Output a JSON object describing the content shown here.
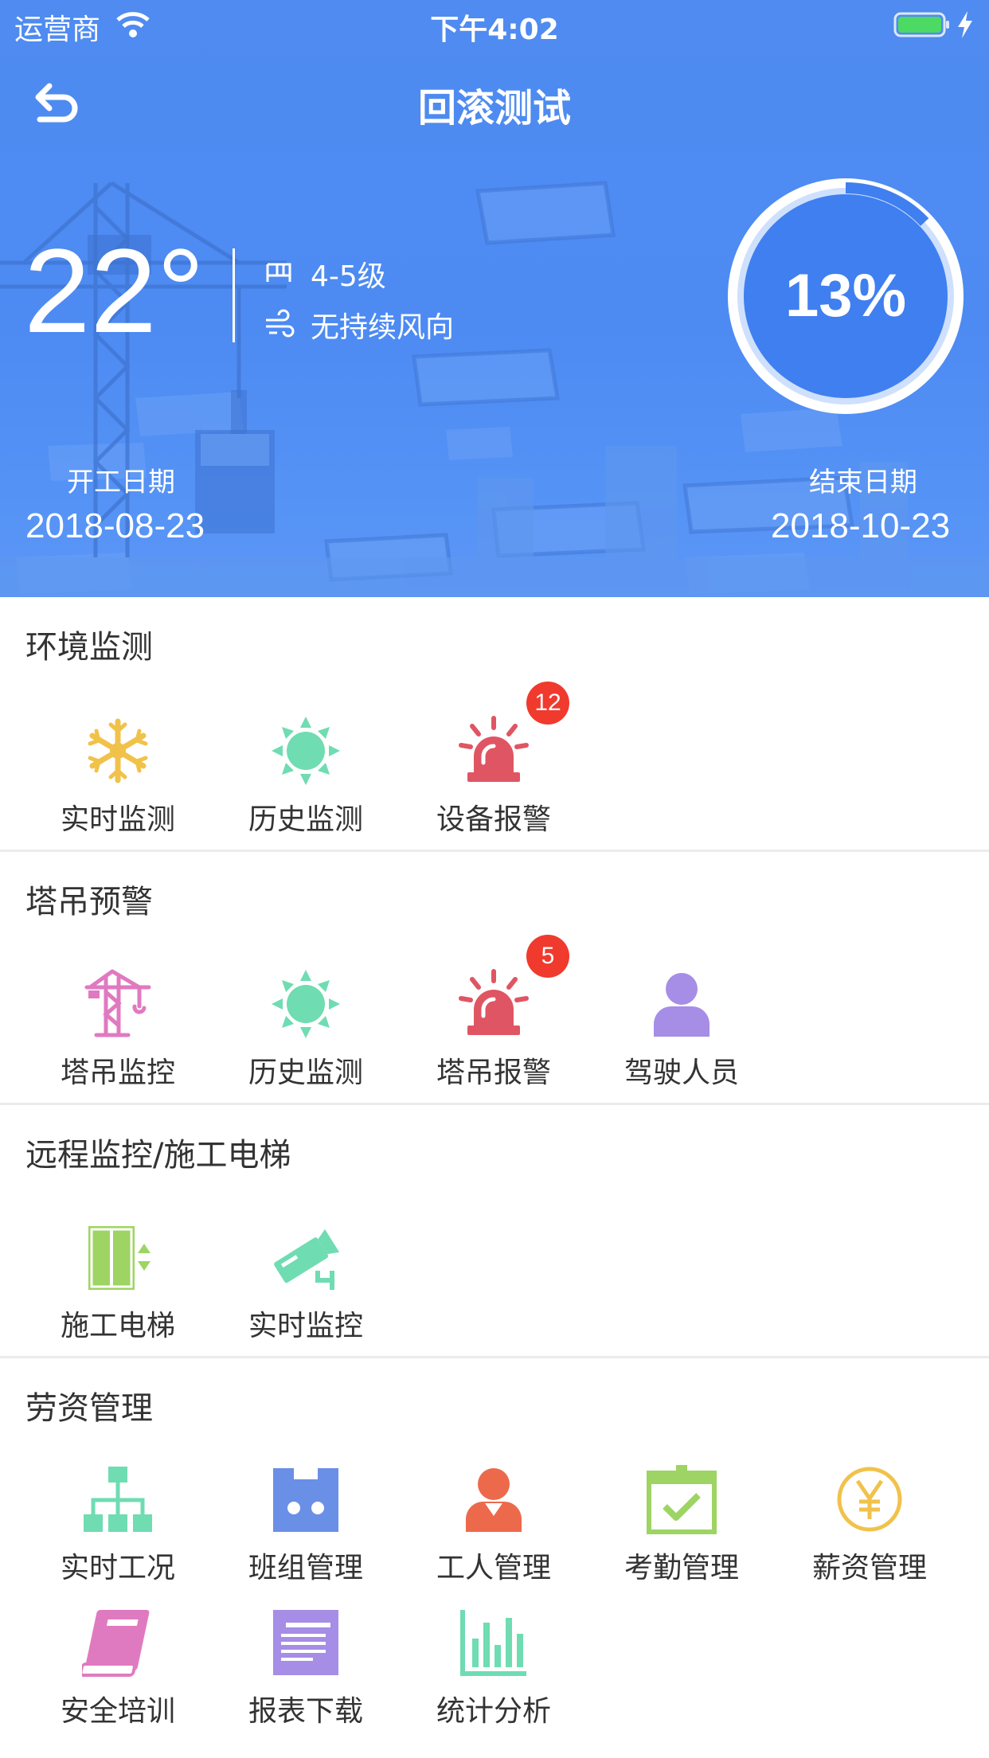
{
  "status_bar": {
    "carrier": "运营商",
    "time": "下午4:02"
  },
  "nav": {
    "title": "回滚测试"
  },
  "weather": {
    "temperature": "22°",
    "wind_level": "4-5级",
    "wind_direction": "无持续风向"
  },
  "progress": {
    "value_text": "13%",
    "fraction": 0.13
  },
  "dates": {
    "start_label": "开工日期",
    "start_value": "2018-08-23",
    "end_label": "结束日期",
    "end_value": "2018-10-23"
  },
  "sections": [
    {
      "title": "环境监测",
      "items": [
        {
          "label": "实时监测",
          "icon": "snowflake-icon"
        },
        {
          "label": "历史监测",
          "icon": "sun-icon"
        },
        {
          "label": "设备报警",
          "icon": "alarm-siren-icon",
          "badge": "12"
        }
      ]
    },
    {
      "title": "塔吊预警",
      "items": [
        {
          "label": "塔吊监控",
          "icon": "tower-crane-icon"
        },
        {
          "label": "历史监测",
          "icon": "sun-icon"
        },
        {
          "label": "塔吊报警",
          "icon": "alarm-siren-icon",
          "badge": "5"
        },
        {
          "label": "驾驶人员",
          "icon": "person-icon"
        }
      ]
    },
    {
      "title": "远程监控/施工电梯",
      "items": [
        {
          "label": "施工电梯",
          "icon": "elevator-icon"
        },
        {
          "label": "实时监控",
          "icon": "security-camera-icon"
        }
      ]
    },
    {
      "title": "劳资管理",
      "items": [
        {
          "label": "实时工况",
          "icon": "org-chart-icon"
        },
        {
          "label": "班组管理",
          "icon": "team-icon"
        },
        {
          "label": "工人管理",
          "icon": "worker-icon"
        },
        {
          "label": "考勤管理",
          "icon": "attendance-calendar-icon"
        },
        {
          "label": "薪资管理",
          "icon": "yuan-coin-icon"
        },
        {
          "label": "安全培训",
          "icon": "book-icon"
        },
        {
          "label": "报表下载",
          "icon": "report-icon"
        },
        {
          "label": "统计分析",
          "icon": "bar-chart-icon"
        }
      ]
    }
  ],
  "colors": {
    "hero_blue": "#4d8bf3",
    "ring_blue": "#3f7ff0",
    "badge_red": "#f03a2e",
    "alarm_red": "#e05563",
    "mint": "#6fdcb2",
    "gold": "#f1c24a",
    "pink": "#e07ac0",
    "purple": "#a68de6",
    "green": "#9dd463"
  }
}
